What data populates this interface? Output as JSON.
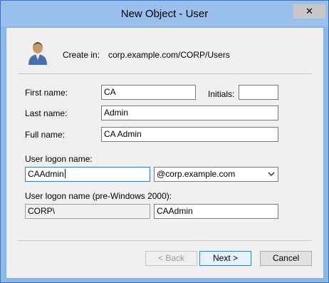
{
  "window": {
    "title": "New Object - User",
    "close_glyph": "✕"
  },
  "header": {
    "icon": "user-icon",
    "create_in_label": "Create in:",
    "create_in_path": "corp.example.com/CORP/Users"
  },
  "form": {
    "first_name_label": "First name:",
    "first_name_value": "CA",
    "initials_label": "Initials:",
    "initials_value": "",
    "last_name_label": "Last name:",
    "last_name_value": "Admin",
    "full_name_label": "Full name:",
    "full_name_value": "CA Admin",
    "logon_name_label": "User logon name:",
    "logon_name_value": "CAAdmin",
    "upn_suffix_selected": "@corp.example.com",
    "pre2000_label": "User logon name (pre-Windows 2000):",
    "pre2000_domain": "CORP\\",
    "pre2000_name": "CAAdmin"
  },
  "buttons": {
    "back": "< Back",
    "next": "Next >",
    "cancel": "Cancel"
  },
  "colors": {
    "titlebar": "#99c0ec",
    "client": "#f0f0f0",
    "default_button_border": "#3c7fb1"
  }
}
